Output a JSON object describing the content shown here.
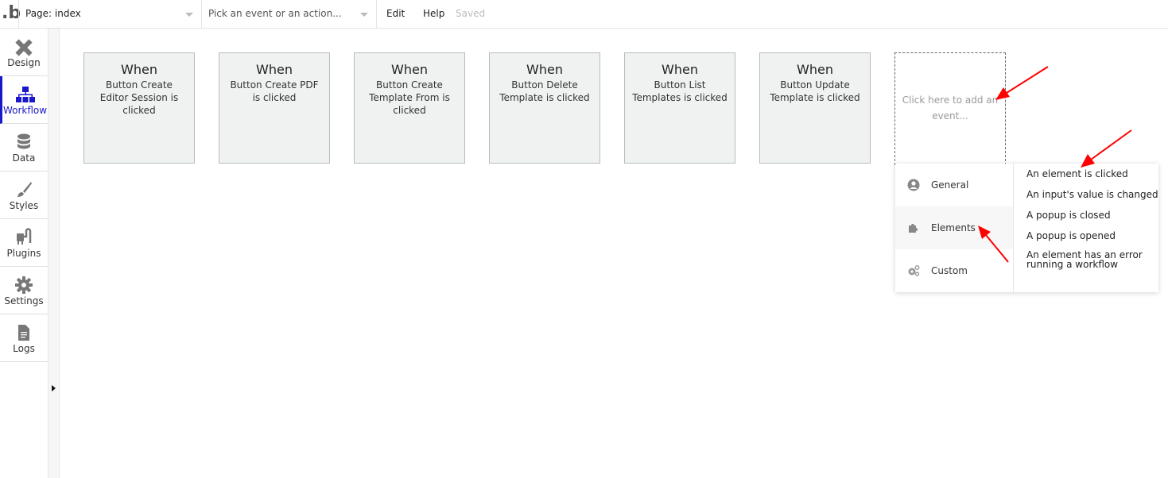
{
  "topbar": {
    "logo": ".b",
    "page_select": "Page: index",
    "event_select_placeholder": "Pick an event or an action...",
    "menu_edit": "Edit",
    "menu_help": "Help",
    "save_status": "Saved"
  },
  "sidebar": {
    "items": [
      {
        "label": "Design",
        "icon": "design-icon"
      },
      {
        "label": "Workflow",
        "icon": "workflow-icon",
        "active": true
      },
      {
        "label": "Data",
        "icon": "database-icon"
      },
      {
        "label": "Styles",
        "icon": "brush-icon"
      },
      {
        "label": "Plugins",
        "icon": "plug-icon"
      },
      {
        "label": "Settings",
        "icon": "gear-icon"
      },
      {
        "label": "Logs",
        "icon": "document-icon"
      }
    ]
  },
  "events": [
    {
      "title": "When",
      "description": "Button Create Editor Session is clicked"
    },
    {
      "title": "When",
      "description": "Button Create PDF is clicked"
    },
    {
      "title": "When",
      "description": "Button Create Template From is clicked"
    },
    {
      "title": "When",
      "description": "Button Delete Template is clicked"
    },
    {
      "title": "When",
      "description": "Button List Templates is clicked"
    },
    {
      "title": "When",
      "description": "Button Update Template is clicked"
    }
  ],
  "add_event": {
    "label": "Click here to add an event..."
  },
  "event_menu": {
    "categories": [
      {
        "label": "General",
        "icon": "user-circle-icon"
      },
      {
        "label": "Elements",
        "icon": "puzzle-icon",
        "selected": true
      },
      {
        "label": "Custom",
        "icon": "gears-icon"
      }
    ],
    "options": [
      "An element is clicked",
      "An input's value is changed",
      "A popup is closed",
      "A popup is opened",
      "An element has an error running a workflow"
    ]
  },
  "colors": {
    "accent": "#1a19c9",
    "annotation_arrow": "#ff0000",
    "card_bg": "#f0f2f1"
  }
}
